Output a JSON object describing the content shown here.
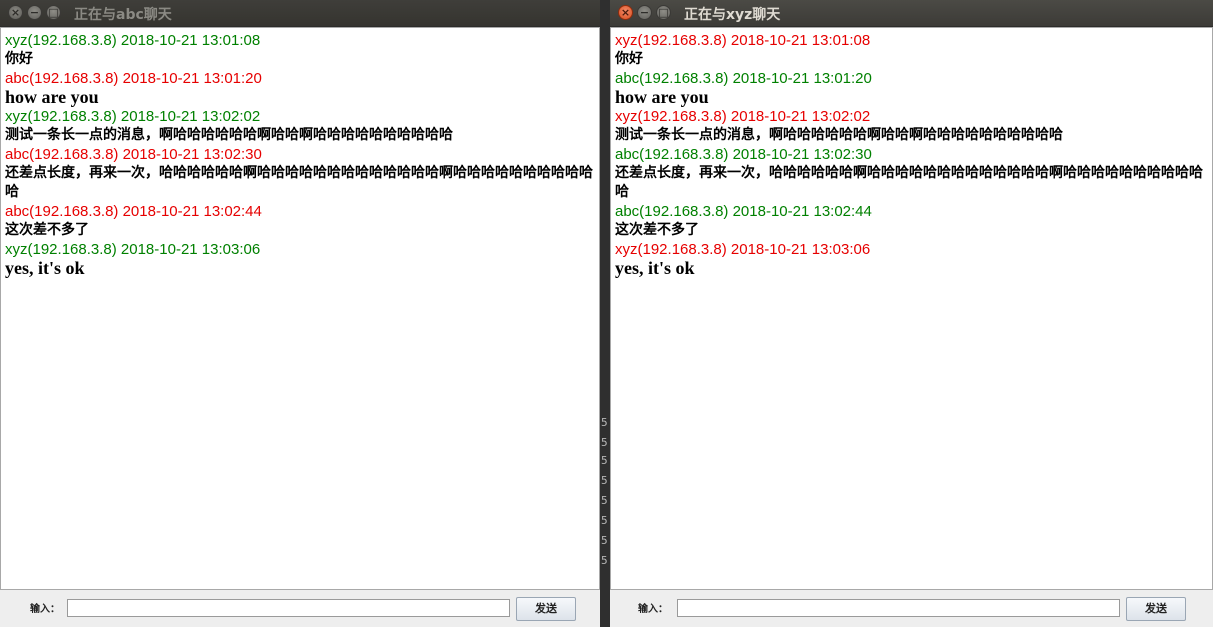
{
  "left_window": {
    "title": "正在与abc聊天",
    "messages": [
      {
        "header": "xyz(192.168.3.8) 2018-10-21 13:01:08",
        "color": "green",
        "body": "你好",
        "latin": false
      },
      {
        "header": "abc(192.168.3.8) 2018-10-21 13:01:20",
        "color": "red",
        "body": "how are you",
        "latin": true
      },
      {
        "header": "xyz(192.168.3.8) 2018-10-21 13:02:02",
        "color": "green",
        "body": "测试一条长一点的消息，啊哈哈哈哈哈哈啊哈哈啊哈哈哈哈哈哈哈哈哈哈",
        "latin": false
      },
      {
        "header": "abc(192.168.3.8) 2018-10-21 13:02:30",
        "color": "red",
        "body": "还差点长度，再来一次，哈哈哈哈哈哈啊哈哈哈哈哈哈哈哈哈哈哈哈哈啊哈哈哈哈哈哈哈哈哈哈哈",
        "latin": false
      },
      {
        "header": "abc(192.168.3.8) 2018-10-21 13:02:44",
        "color": "red",
        "body": "这次差不多了",
        "latin": false
      },
      {
        "header": "xyz(192.168.3.8) 2018-10-21 13:03:06",
        "color": "green",
        "body": "yes, it's ok",
        "latin": true
      }
    ],
    "input_label": "输入：",
    "input_value": "",
    "send_label": "发送"
  },
  "right_window": {
    "title": "正在与xyz聊天",
    "messages": [
      {
        "header": "xyz(192.168.3.8) 2018-10-21 13:01:08",
        "color": "red",
        "body": "你好",
        "latin": false
      },
      {
        "header": "abc(192.168.3.8) 2018-10-21 13:01:20",
        "color": "green",
        "body": "how are you",
        "latin": true
      },
      {
        "header": "xyz(192.168.3.8) 2018-10-21 13:02:02",
        "color": "red",
        "body": "测试一条长一点的消息，啊哈哈哈哈哈哈啊哈哈啊哈哈哈哈哈哈哈哈哈哈",
        "latin": false
      },
      {
        "header": "abc(192.168.3.8) 2018-10-21 13:02:30",
        "color": "green",
        "body": "还差点长度，再来一次，哈哈哈哈哈哈啊哈哈哈哈哈哈哈哈哈哈哈哈哈啊哈哈哈哈哈哈哈哈哈哈哈",
        "latin": false
      },
      {
        "header": "abc(192.168.3.8) 2018-10-21 13:02:44",
        "color": "green",
        "body": "这次差不多了",
        "latin": false
      },
      {
        "header": "xyz(192.168.3.8) 2018-10-21 13:03:06",
        "color": "red",
        "body": "yes, it's ok",
        "latin": true
      }
    ],
    "input_label": "输入：",
    "input_value": "",
    "send_label": "发送"
  },
  "colors": {
    "green": "#008000",
    "red": "#e60000"
  },
  "titlebar_buttons": {
    "close": "×",
    "minimize": "−",
    "maximize": "□"
  }
}
